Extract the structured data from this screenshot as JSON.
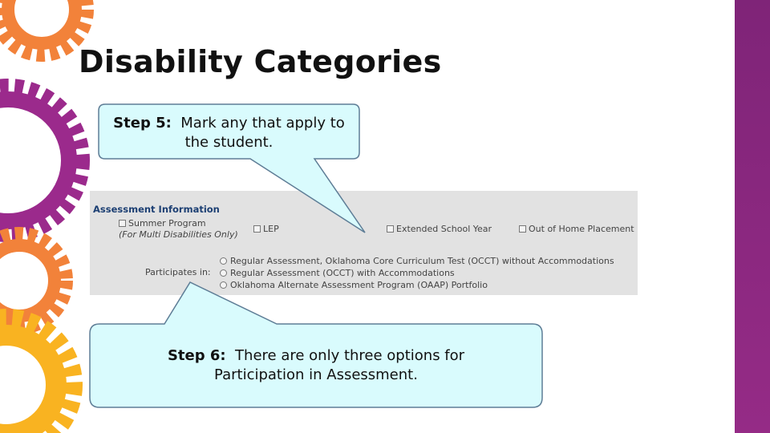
{
  "title": "Disability Categories",
  "callout_step5": {
    "step": "Step 5:",
    "line1": "Mark any that apply to",
    "line2": "the student."
  },
  "callout_step6": {
    "step": "Step 6:",
    "line1": "There are only three options for",
    "line2": "Participation in Assessment."
  },
  "assessment_panel": {
    "heading": "Assessment Information",
    "checkboxes": {
      "summer_program": "Summer Program",
      "lep": "LEP",
      "extended_school_year": "Extended School Year",
      "out_of_home_placement": "Out of Home Placement"
    },
    "multi_disabilities_note": "(For Multi Disabilities Only)",
    "participates_label": "Participates in:",
    "participation_options": [
      "Regular Assessment, Oklahoma Core Curriculum Test (OCCT) without Accommodations",
      "Regular Assessment (OCCT) with Accommodations",
      "Oklahoma Alternate Assessment Program (OAAP) Portfolio"
    ]
  },
  "colors": {
    "gear_orange": "#f2823a",
    "gear_purple": "#9b2a8c",
    "gear_yellow": "#f9b321",
    "right_bar": "#8e2a84",
    "callout_fill": "#d9fbfd",
    "callout_border": "#5e7d96",
    "panel_bg": "#e2e2e2",
    "heading_blue": "#1c3f73"
  }
}
